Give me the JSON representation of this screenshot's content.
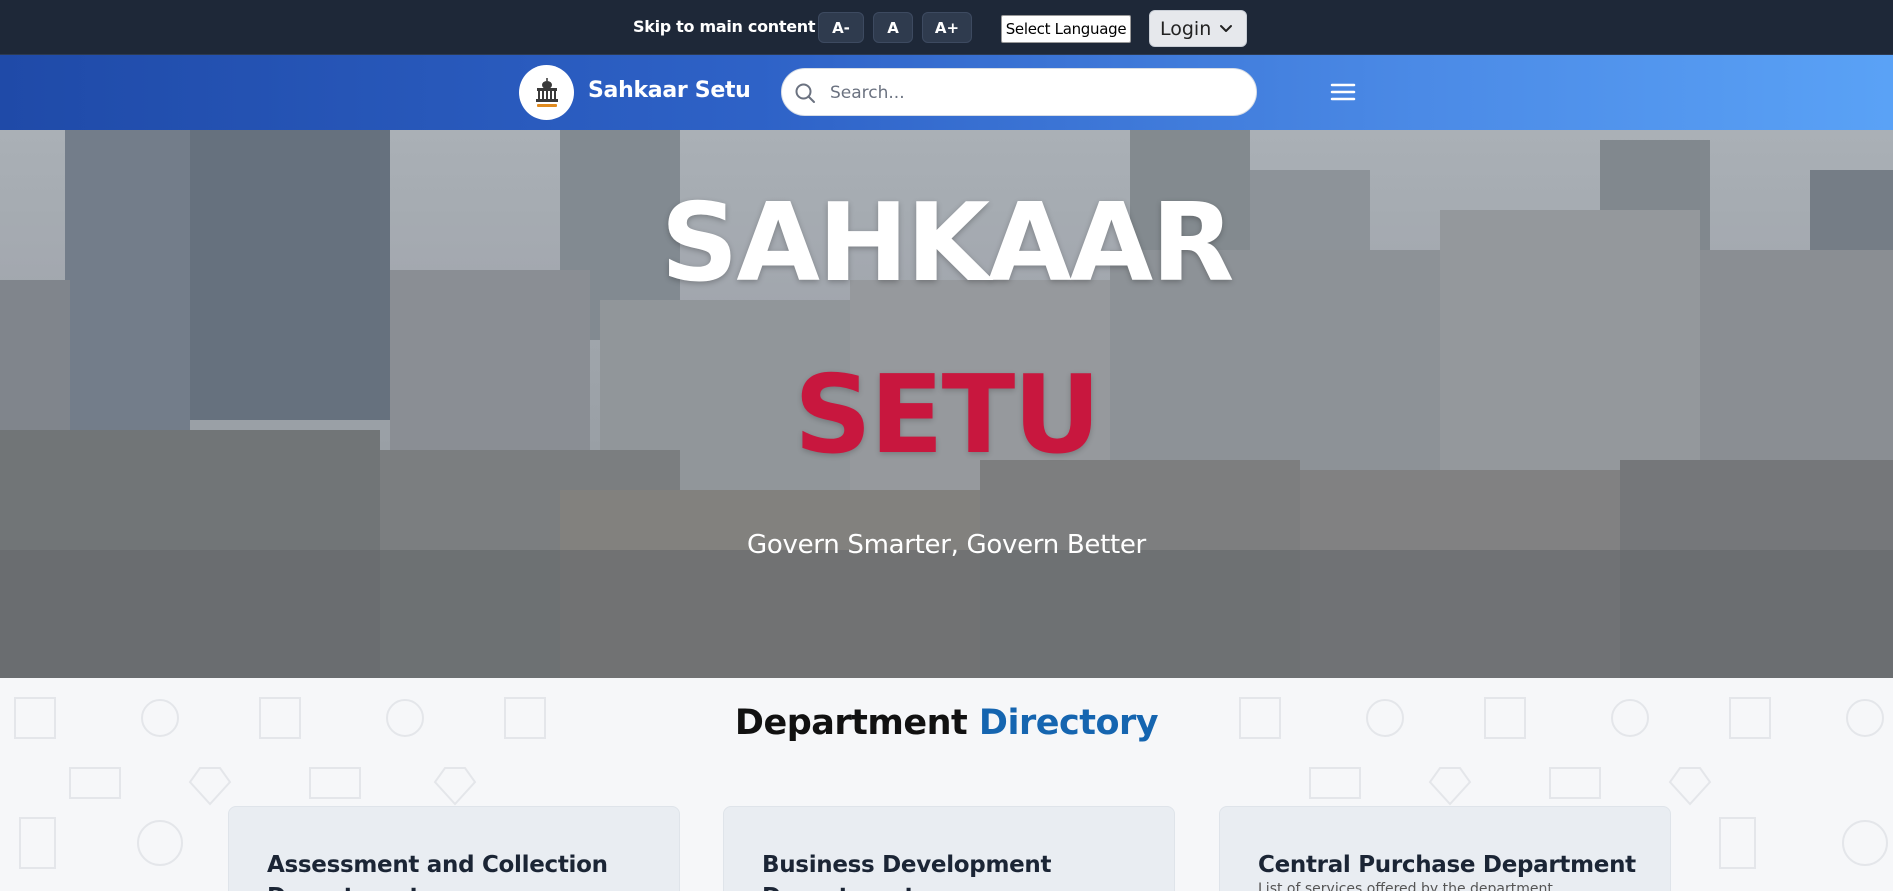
{
  "topbar": {
    "skip_link": "Skip to main content",
    "font_decrease": "A-",
    "font_normal": "A",
    "font_increase": "A+",
    "language_select": "Select Language",
    "login_label": "Login"
  },
  "navbar": {
    "brand_name": "Sahkaar Setu",
    "search_placeholder": "Search..."
  },
  "hero": {
    "title_line1": "SAHKAAR",
    "title_line2": "SETU",
    "tagline": "Govern Smarter, Govern Better"
  },
  "directory": {
    "heading_part1": "Department",
    "heading_part2": "Directory",
    "cards": [
      {
        "title": "Assessment and Collection Department",
        "subtitle": ""
      },
      {
        "title": "Business Development Department",
        "subtitle": ""
      },
      {
        "title": "Central Purchase Department",
        "subtitle": "List of services offered by the department"
      }
    ]
  },
  "colors": {
    "topbar_bg": "#1e2838",
    "nav_gradient_start": "#1f4aa8",
    "nav_gradient_end": "#5aa2f6",
    "hero_title_accent": "#c8173e",
    "directory_accent": "#1565b0"
  },
  "icons": [
    "search-icon",
    "menu-icon",
    "chevron-down-icon",
    "logo-emblem-icon"
  ]
}
